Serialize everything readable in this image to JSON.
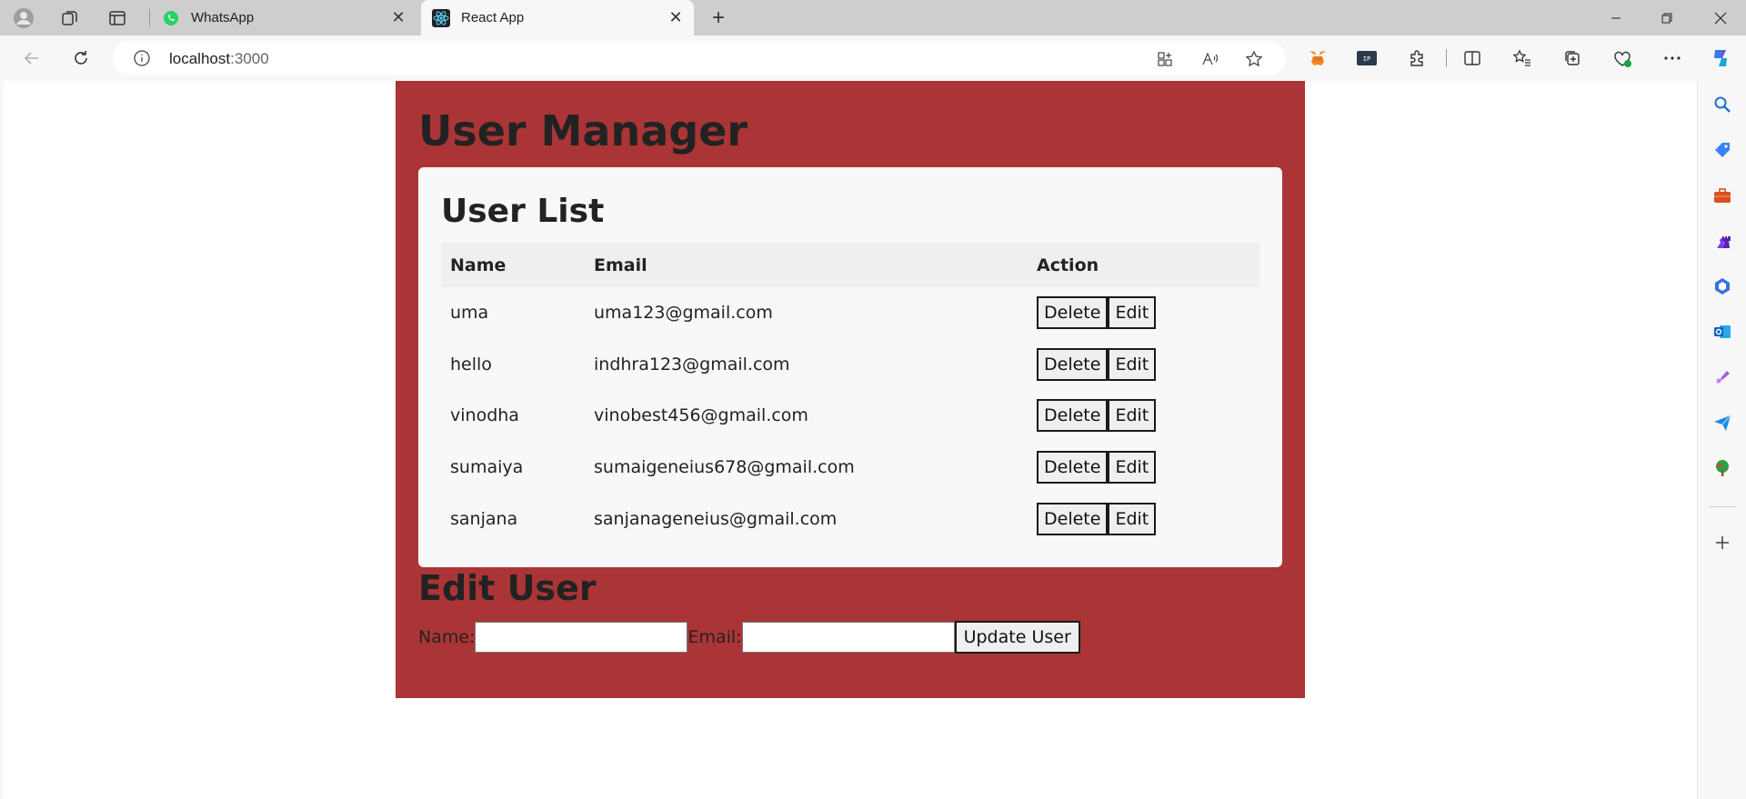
{
  "browser": {
    "tabs": [
      {
        "title": "WhatsApp",
        "active": false,
        "favicon": "whatsapp-icon"
      },
      {
        "title": "React App",
        "active": true,
        "favicon": "react-icon"
      }
    ],
    "address": {
      "host": "localhost",
      "port": ":3000"
    }
  },
  "app": {
    "title": "User Manager",
    "list_title": "User List",
    "columns": {
      "name": "Name",
      "email": "Email",
      "action": "Action"
    },
    "users": [
      {
        "name": "uma",
        "email": "uma123@gmail.com"
      },
      {
        "name": "hello",
        "email": "indhra123@gmail.com"
      },
      {
        "name": "vinodha",
        "email": "vinobest456@gmail.com"
      },
      {
        "name": "sumaiya",
        "email": "sumaigeneius678@gmail.com"
      },
      {
        "name": "sanjana",
        "email": "sanjanageneius@gmail.com"
      }
    ],
    "actions": {
      "delete": "Delete",
      "edit": "Edit"
    },
    "edit_form": {
      "title": "Edit User",
      "name_label": "Name:",
      "email_label": "Email:",
      "name_value": "",
      "email_value": "",
      "submit_label": "Update User"
    }
  },
  "colors": {
    "app_background": "#ab3536",
    "card_background": "#f7f8f9",
    "chrome": "#f7f7f7",
    "tabstrip": "#cecece"
  }
}
